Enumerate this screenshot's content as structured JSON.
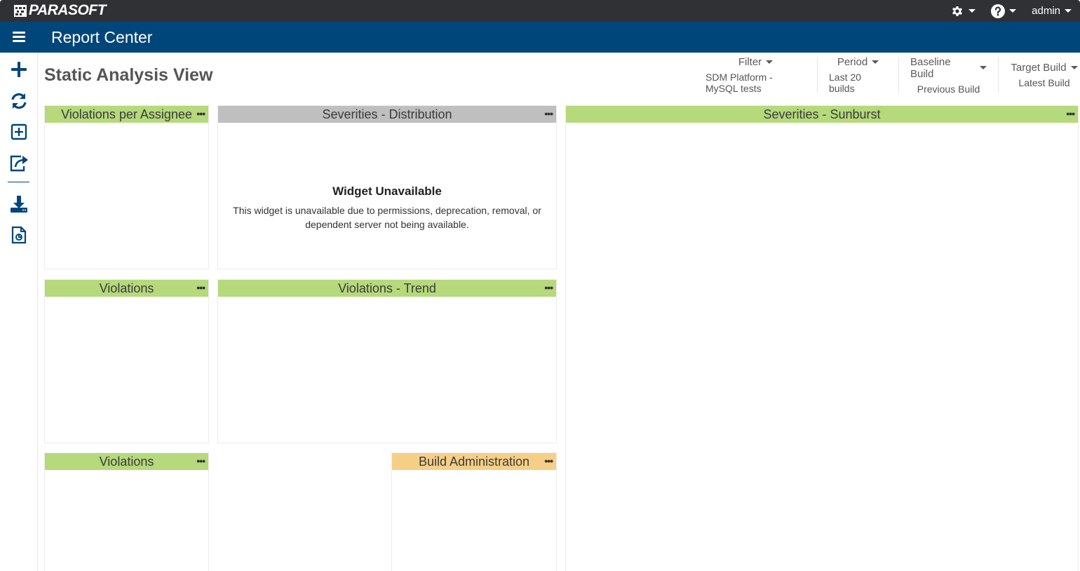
{
  "topbar": {
    "logo_text": "PARASOFT",
    "settings_icon": "gear-icon",
    "help_icon": "question-circle-icon",
    "user_label": "admin"
  },
  "header": {
    "menu_icon": "hamburger-icon",
    "title": "Report Center"
  },
  "sidebar": {
    "items": [
      {
        "icon": "plus-icon"
      },
      {
        "icon": "refresh-icon"
      },
      {
        "icon": "add-widget-icon"
      },
      {
        "icon": "share-icon"
      },
      {
        "icon": "download-icon"
      },
      {
        "icon": "report-file-icon"
      }
    ]
  },
  "page": {
    "title": "Static Analysis View"
  },
  "selectors": [
    {
      "label": "Filter",
      "value": "SDM Platform - MySQL tests"
    },
    {
      "label": "Period",
      "value": "Last 20 builds"
    },
    {
      "label": "Baseline Build",
      "value": "Previous Build"
    },
    {
      "label": "Target Build",
      "value": "Latest Build"
    }
  ],
  "widgets": {
    "violations_per_assignee": {
      "title": "Violations per Assignee"
    },
    "severities_distribution": {
      "title": "Severities - Distribution",
      "unavailable_title": "Widget Unavailable",
      "unavailable_message": "This widget is unavailable due to permissions, deprecation, removal, or dependent server not being available."
    },
    "severities_sunburst": {
      "title": "Severities - Sunburst"
    },
    "violations_1": {
      "title": "Violations"
    },
    "violations_trend": {
      "title": "Violations - Trend"
    },
    "violations_2": {
      "title": "Violations"
    },
    "build_administration": {
      "title": "Build Administration"
    },
    "menu_glyph": "•••"
  },
  "colors": {
    "topbar": "#303134",
    "header": "#00467a",
    "widget_ok": "#b5d97b",
    "widget_unavailable": "#bfbfbf",
    "widget_admin": "#f6cf86"
  }
}
